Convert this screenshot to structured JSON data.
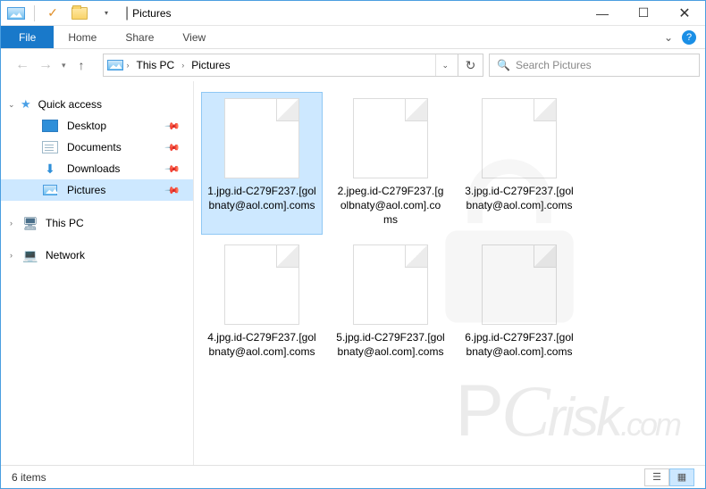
{
  "window": {
    "title": "Pictures"
  },
  "ribbon": {
    "file": "File",
    "tabs": [
      "Home",
      "Share",
      "View"
    ]
  },
  "breadcrumb": {
    "root": "This PC",
    "current": "Pictures"
  },
  "search": {
    "placeholder": "Search Pictures"
  },
  "sidebar": {
    "quick_access": "Quick access",
    "items": [
      {
        "label": "Desktop"
      },
      {
        "label": "Documents"
      },
      {
        "label": "Downloads"
      },
      {
        "label": "Pictures"
      }
    ],
    "this_pc": "This PC",
    "network": "Network"
  },
  "files": [
    {
      "name": "1.jpg.id-C279F237.[golbnaty@aol.com].coms"
    },
    {
      "name": "2.jpeg.id-C279F237.[golbnaty@aol.com].coms"
    },
    {
      "name": "3.jpg.id-C279F237.[golbnaty@aol.com].coms"
    },
    {
      "name": "4.jpg.id-C279F237.[golbnaty@aol.com].coms"
    },
    {
      "name": "5.jpg.id-C279F237.[golbnaty@aol.com].coms"
    },
    {
      "name": "6.jpg.id-C279F237.[golbnaty@aol.com].coms"
    }
  ],
  "status": {
    "count": "6 items"
  }
}
